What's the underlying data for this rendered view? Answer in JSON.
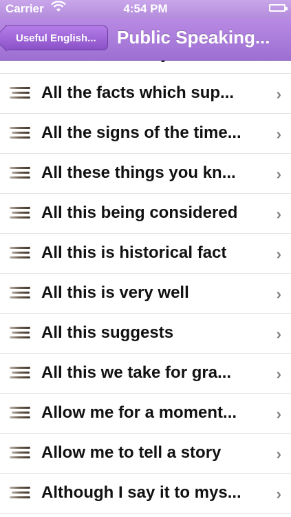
{
  "status_bar": {
    "carrier": "Carrier",
    "time": "4:54 PM"
  },
  "nav": {
    "back_label": "Useful English...",
    "title": "Public Speaking..."
  },
  "rows": [
    "All that I will say now",
    "All the facts which sup...",
    "All the signs of the time...",
    "All these things you kn...",
    "All this being considered",
    "All this is historical fact",
    "All this is very well",
    "All this suggests",
    "All this we take for gra...",
    "Allow me for a moment...",
    "Allow me to tell a story",
    "Although I say it to mys..."
  ],
  "icons": {
    "row_icon": "menu-lines-icon",
    "disclosure": "chevron-right-icon",
    "wifi": "wifi-icon",
    "battery": "battery-icon"
  },
  "colors": {
    "nav_purple": "#9d6fd2",
    "back_button": "#8a52c8"
  }
}
